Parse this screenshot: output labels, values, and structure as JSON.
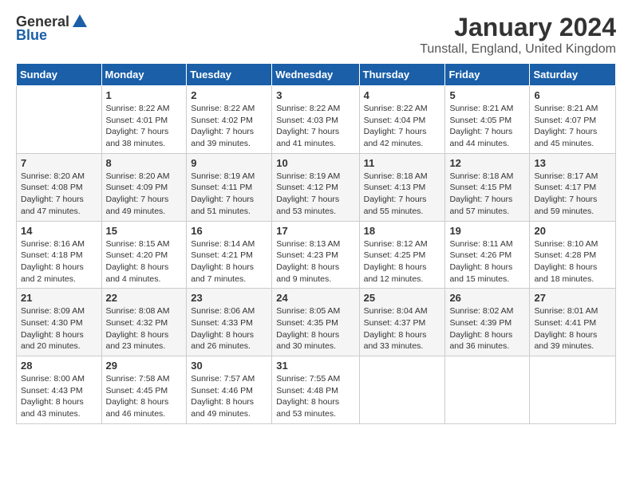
{
  "logo": {
    "general": "General",
    "blue": "Blue"
  },
  "title": "January 2024",
  "location": "Tunstall, England, United Kingdom",
  "days_of_week": [
    "Sunday",
    "Monday",
    "Tuesday",
    "Wednesday",
    "Thursday",
    "Friday",
    "Saturday"
  ],
  "weeks": [
    [
      {
        "day": "",
        "sunrise": "",
        "sunset": "",
        "daylight": ""
      },
      {
        "day": "1",
        "sunrise": "Sunrise: 8:22 AM",
        "sunset": "Sunset: 4:01 PM",
        "daylight": "Daylight: 7 hours and 38 minutes."
      },
      {
        "day": "2",
        "sunrise": "Sunrise: 8:22 AM",
        "sunset": "Sunset: 4:02 PM",
        "daylight": "Daylight: 7 hours and 39 minutes."
      },
      {
        "day": "3",
        "sunrise": "Sunrise: 8:22 AM",
        "sunset": "Sunset: 4:03 PM",
        "daylight": "Daylight: 7 hours and 41 minutes."
      },
      {
        "day": "4",
        "sunrise": "Sunrise: 8:22 AM",
        "sunset": "Sunset: 4:04 PM",
        "daylight": "Daylight: 7 hours and 42 minutes."
      },
      {
        "day": "5",
        "sunrise": "Sunrise: 8:21 AM",
        "sunset": "Sunset: 4:05 PM",
        "daylight": "Daylight: 7 hours and 44 minutes."
      },
      {
        "day": "6",
        "sunrise": "Sunrise: 8:21 AM",
        "sunset": "Sunset: 4:07 PM",
        "daylight": "Daylight: 7 hours and 45 minutes."
      }
    ],
    [
      {
        "day": "7",
        "sunrise": "Sunrise: 8:20 AM",
        "sunset": "Sunset: 4:08 PM",
        "daylight": "Daylight: 7 hours and 47 minutes."
      },
      {
        "day": "8",
        "sunrise": "Sunrise: 8:20 AM",
        "sunset": "Sunset: 4:09 PM",
        "daylight": "Daylight: 7 hours and 49 minutes."
      },
      {
        "day": "9",
        "sunrise": "Sunrise: 8:19 AM",
        "sunset": "Sunset: 4:11 PM",
        "daylight": "Daylight: 7 hours and 51 minutes."
      },
      {
        "day": "10",
        "sunrise": "Sunrise: 8:19 AM",
        "sunset": "Sunset: 4:12 PM",
        "daylight": "Daylight: 7 hours and 53 minutes."
      },
      {
        "day": "11",
        "sunrise": "Sunrise: 8:18 AM",
        "sunset": "Sunset: 4:13 PM",
        "daylight": "Daylight: 7 hours and 55 minutes."
      },
      {
        "day": "12",
        "sunrise": "Sunrise: 8:18 AM",
        "sunset": "Sunset: 4:15 PM",
        "daylight": "Daylight: 7 hours and 57 minutes."
      },
      {
        "day": "13",
        "sunrise": "Sunrise: 8:17 AM",
        "sunset": "Sunset: 4:17 PM",
        "daylight": "Daylight: 7 hours and 59 minutes."
      }
    ],
    [
      {
        "day": "14",
        "sunrise": "Sunrise: 8:16 AM",
        "sunset": "Sunset: 4:18 PM",
        "daylight": "Daylight: 8 hours and 2 minutes."
      },
      {
        "day": "15",
        "sunrise": "Sunrise: 8:15 AM",
        "sunset": "Sunset: 4:20 PM",
        "daylight": "Daylight: 8 hours and 4 minutes."
      },
      {
        "day": "16",
        "sunrise": "Sunrise: 8:14 AM",
        "sunset": "Sunset: 4:21 PM",
        "daylight": "Daylight: 8 hours and 7 minutes."
      },
      {
        "day": "17",
        "sunrise": "Sunrise: 8:13 AM",
        "sunset": "Sunset: 4:23 PM",
        "daylight": "Daylight: 8 hours and 9 minutes."
      },
      {
        "day": "18",
        "sunrise": "Sunrise: 8:12 AM",
        "sunset": "Sunset: 4:25 PM",
        "daylight": "Daylight: 8 hours and 12 minutes."
      },
      {
        "day": "19",
        "sunrise": "Sunrise: 8:11 AM",
        "sunset": "Sunset: 4:26 PM",
        "daylight": "Daylight: 8 hours and 15 minutes."
      },
      {
        "day": "20",
        "sunrise": "Sunrise: 8:10 AM",
        "sunset": "Sunset: 4:28 PM",
        "daylight": "Daylight: 8 hours and 18 minutes."
      }
    ],
    [
      {
        "day": "21",
        "sunrise": "Sunrise: 8:09 AM",
        "sunset": "Sunset: 4:30 PM",
        "daylight": "Daylight: 8 hours and 20 minutes."
      },
      {
        "day": "22",
        "sunrise": "Sunrise: 8:08 AM",
        "sunset": "Sunset: 4:32 PM",
        "daylight": "Daylight: 8 hours and 23 minutes."
      },
      {
        "day": "23",
        "sunrise": "Sunrise: 8:06 AM",
        "sunset": "Sunset: 4:33 PM",
        "daylight": "Daylight: 8 hours and 26 minutes."
      },
      {
        "day": "24",
        "sunrise": "Sunrise: 8:05 AM",
        "sunset": "Sunset: 4:35 PM",
        "daylight": "Daylight: 8 hours and 30 minutes."
      },
      {
        "day": "25",
        "sunrise": "Sunrise: 8:04 AM",
        "sunset": "Sunset: 4:37 PM",
        "daylight": "Daylight: 8 hours and 33 minutes."
      },
      {
        "day": "26",
        "sunrise": "Sunrise: 8:02 AM",
        "sunset": "Sunset: 4:39 PM",
        "daylight": "Daylight: 8 hours and 36 minutes."
      },
      {
        "day": "27",
        "sunrise": "Sunrise: 8:01 AM",
        "sunset": "Sunset: 4:41 PM",
        "daylight": "Daylight: 8 hours and 39 minutes."
      }
    ],
    [
      {
        "day": "28",
        "sunrise": "Sunrise: 8:00 AM",
        "sunset": "Sunset: 4:43 PM",
        "daylight": "Daylight: 8 hours and 43 minutes."
      },
      {
        "day": "29",
        "sunrise": "Sunrise: 7:58 AM",
        "sunset": "Sunset: 4:45 PM",
        "daylight": "Daylight: 8 hours and 46 minutes."
      },
      {
        "day": "30",
        "sunrise": "Sunrise: 7:57 AM",
        "sunset": "Sunset: 4:46 PM",
        "daylight": "Daylight: 8 hours and 49 minutes."
      },
      {
        "day": "31",
        "sunrise": "Sunrise: 7:55 AM",
        "sunset": "Sunset: 4:48 PM",
        "daylight": "Daylight: 8 hours and 53 minutes."
      },
      {
        "day": "",
        "sunrise": "",
        "sunset": "",
        "daylight": ""
      },
      {
        "day": "",
        "sunrise": "",
        "sunset": "",
        "daylight": ""
      },
      {
        "day": "",
        "sunrise": "",
        "sunset": "",
        "daylight": ""
      }
    ]
  ]
}
